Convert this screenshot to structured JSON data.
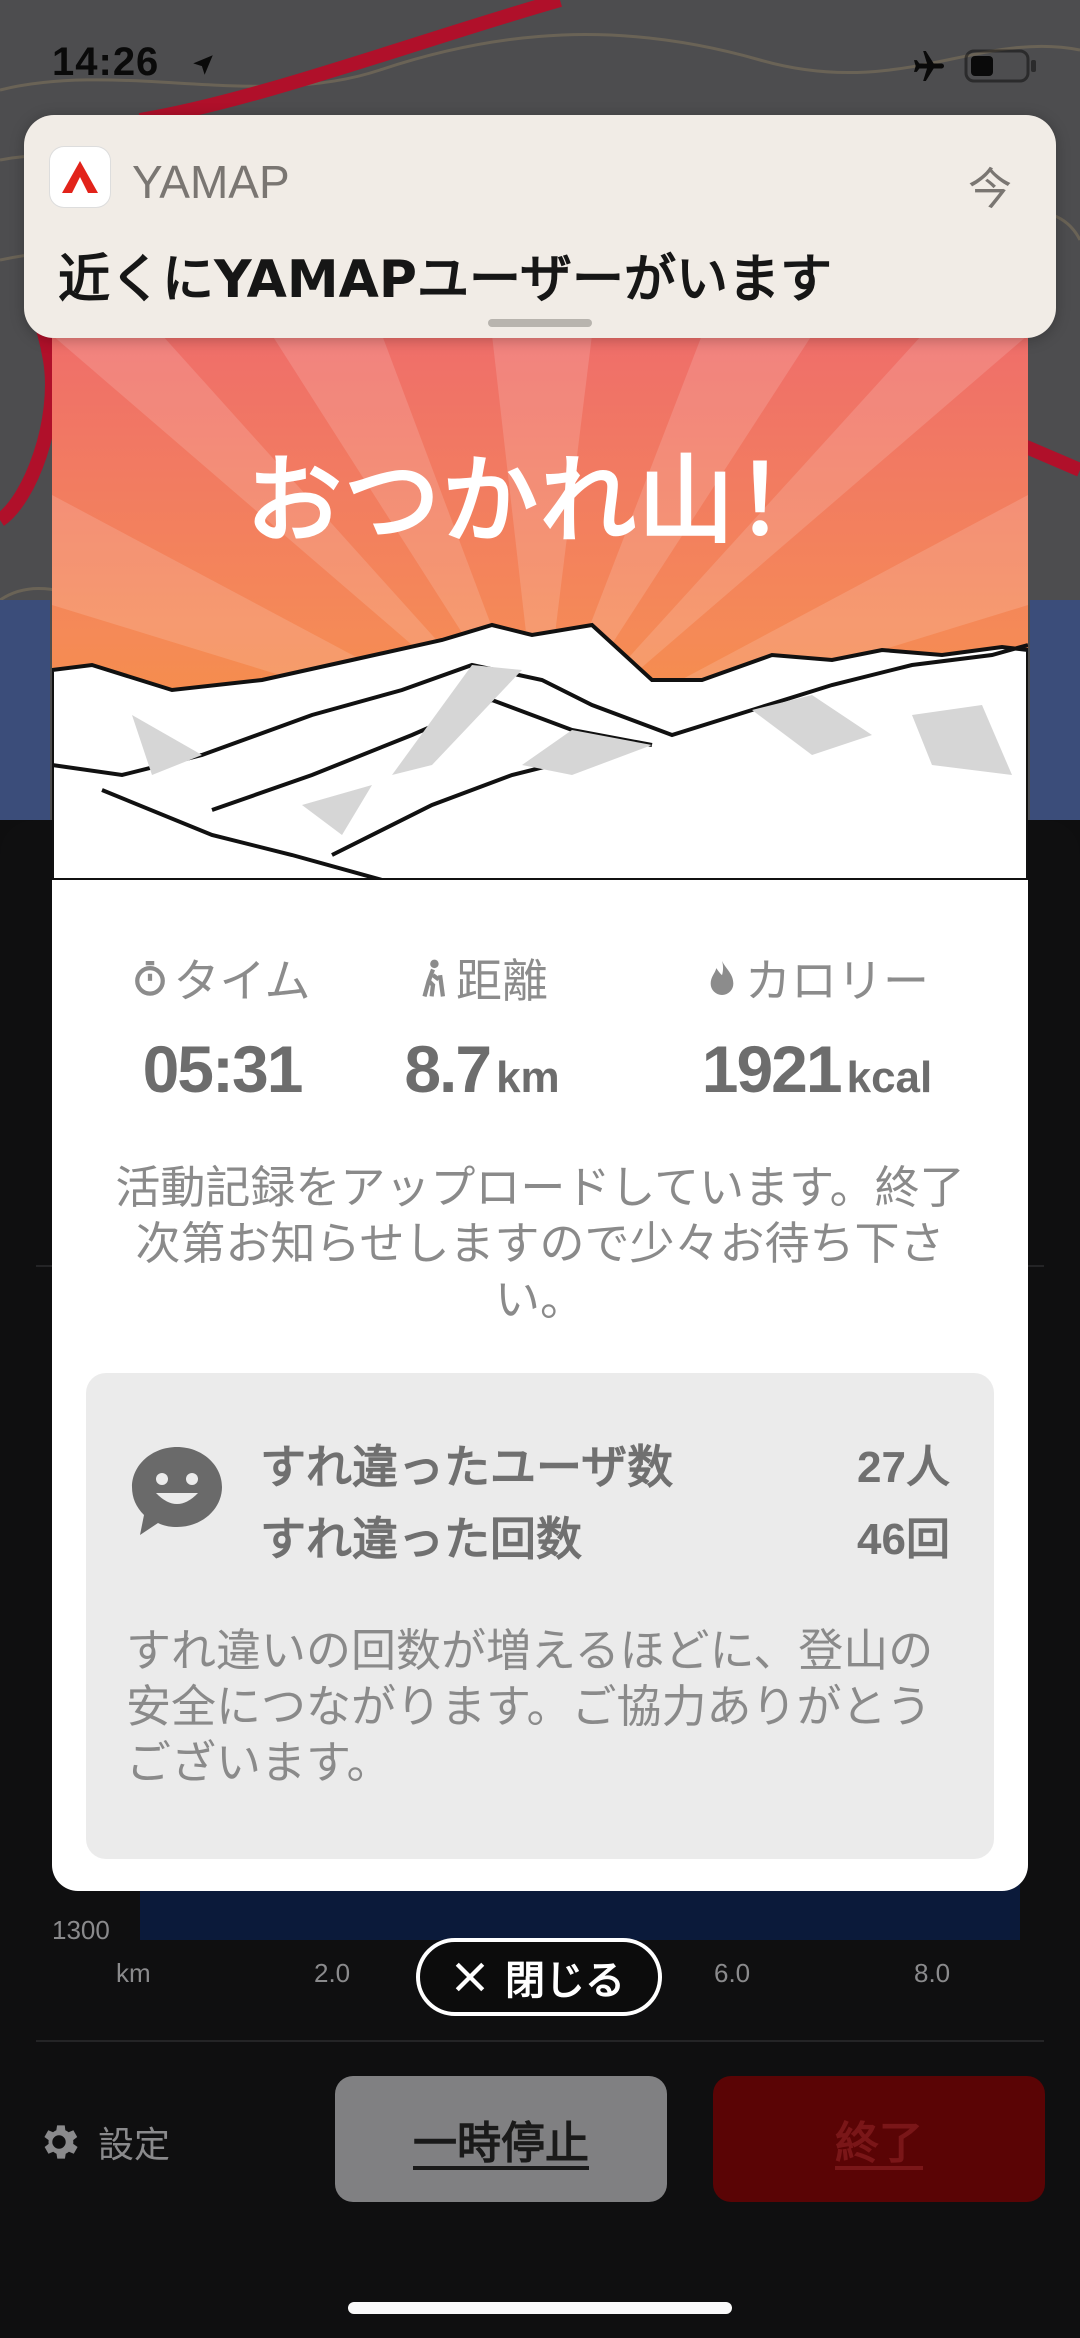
{
  "status_bar": {
    "time": "14:26"
  },
  "notification": {
    "app_name": "YAMAP",
    "time": "今",
    "message": "近くにYAMAPユーザーがいます",
    "brand_color": "#e2231a"
  },
  "modal": {
    "title": "おつかれ山！",
    "stats": [
      {
        "icon": "stopwatch-icon",
        "label": "タイム",
        "value": "05:31",
        "unit": ""
      },
      {
        "icon": "hiker-icon",
        "label": "距離",
        "value": "8.7",
        "unit": "km"
      },
      {
        "icon": "flame-icon",
        "label": "カロリー",
        "value": "1921",
        "unit": "kcal"
      }
    ],
    "upload_message": "活動記録をアップロードしています。終了次第お知らせしますので少々お待ち下さい。",
    "passing": {
      "users_label": "すれ違ったユーザ数",
      "users_value": "27人",
      "count_label": "すれ違った回数",
      "count_value": "46回",
      "note": "すれ違いの回数が増えるほどに、登山の安全につながります。ご協力ありがとうございます。"
    }
  },
  "close_button": {
    "label": "閉じる"
  },
  "background": {
    "chart_y_label": "1300",
    "x_ticks": [
      "km",
      "2.0",
      "6.0",
      "8.0"
    ],
    "settings_label": "設定",
    "pause_label": "一時停止",
    "end_label": "終了"
  }
}
